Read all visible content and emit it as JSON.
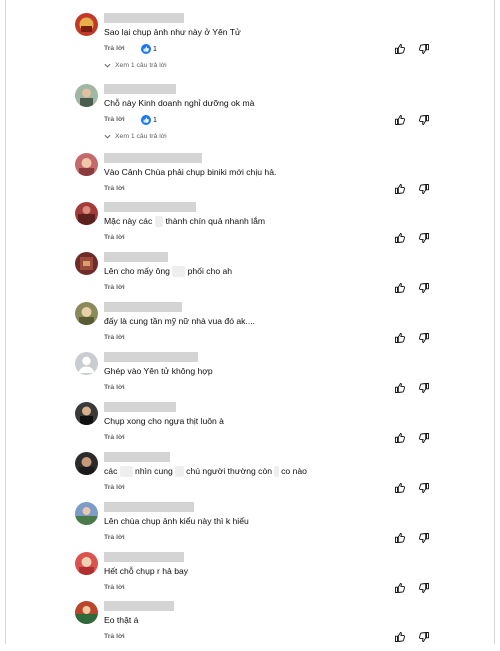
{
  "ui": {
    "reply_label": "Trả lời",
    "view_reply_label": "Xem 1 câu trả lời",
    "accent_like_color": "#1877f2"
  },
  "comments": [
    {
      "text": "Sao lại chụp ảnh như này ở Yên Tử",
      "likes": "1",
      "has_replies": true
    },
    {
      "text": "Chỗ này Kinh doanh nghỉ dưỡng ok mà",
      "likes": "1",
      "has_replies": true
    },
    {
      "text": "Vào Cảnh Chùa phải chụp biniki mới chịu hả."
    },
    {
      "text_a": "Mặc này các",
      "text_b": "thành chín quả nhanh lắm"
    },
    {
      "text_a": "Lên cho mấy ông",
      "text_b": "phối cho ah"
    },
    {
      "text": "đấy là cung tần mỹ nữ nhà vua đó ak...."
    },
    {
      "text": "Ghép vào Yên tử không hợp"
    },
    {
      "text": "Chụp xong cho ngựa thịt luôn à"
    },
    {
      "text_a": "các",
      "text_b": "nhìn cung",
      "text_c": "chú người thường còn",
      "text_d": "co nào"
    },
    {
      "text": "Lên chùa chụp ảnh kiểu này thì k hiểu"
    },
    {
      "text": "Hết chỗ chụp r hả bay"
    },
    {
      "text": "Eo thật á"
    }
  ]
}
